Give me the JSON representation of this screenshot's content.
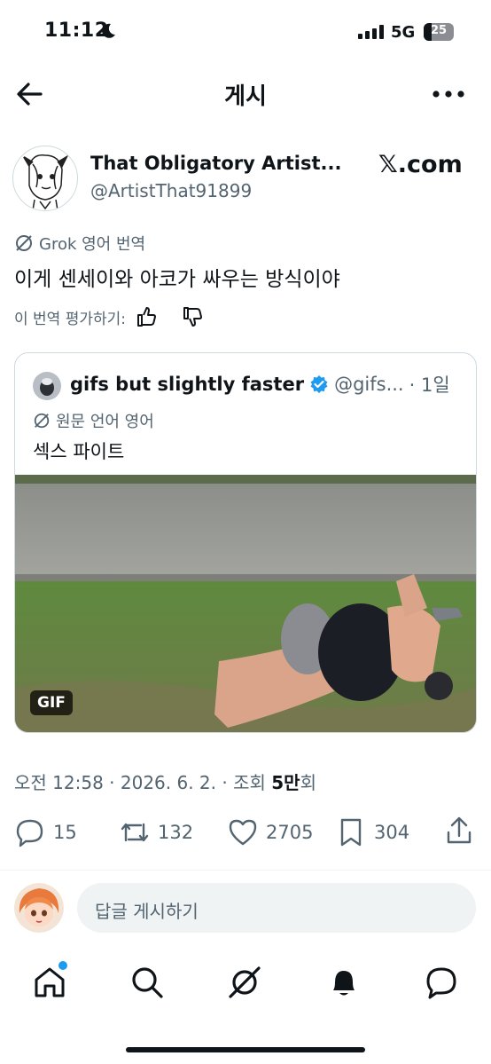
{
  "status": {
    "time": "11:12",
    "network": "5G",
    "battery": "25"
  },
  "header": {
    "title": "게시"
  },
  "author": {
    "name": "That Obligatory Artist...",
    "handle": "@ArtistThat91899"
  },
  "watermark": "𝕏.com",
  "translation": {
    "grok_label": "Grok 영어 번역",
    "text": "이게 센세이와 아코가 싸우는 방식이야",
    "rate_label": "이 번역 평가하기:"
  },
  "quote": {
    "name": "gifs but slightly faster",
    "handle": "@gifs...",
    "time": "· 1일",
    "lang_label": "원문 언어 영어",
    "text": "섹스 파이트",
    "media_badge": "GIF"
  },
  "meta": {
    "datetime": "오전 12:58 · 2026. 6. 2. · 조회",
    "views": "5만",
    "views_suffix": "회"
  },
  "actions": {
    "replies": "15",
    "reposts": "132",
    "likes": "2705",
    "bookmarks": "304"
  },
  "reply": {
    "placeholder": "답글 게시하기"
  },
  "colors": {
    "accent": "#1d9bf0",
    "text": "#0f1419",
    "muted": "#536471"
  }
}
